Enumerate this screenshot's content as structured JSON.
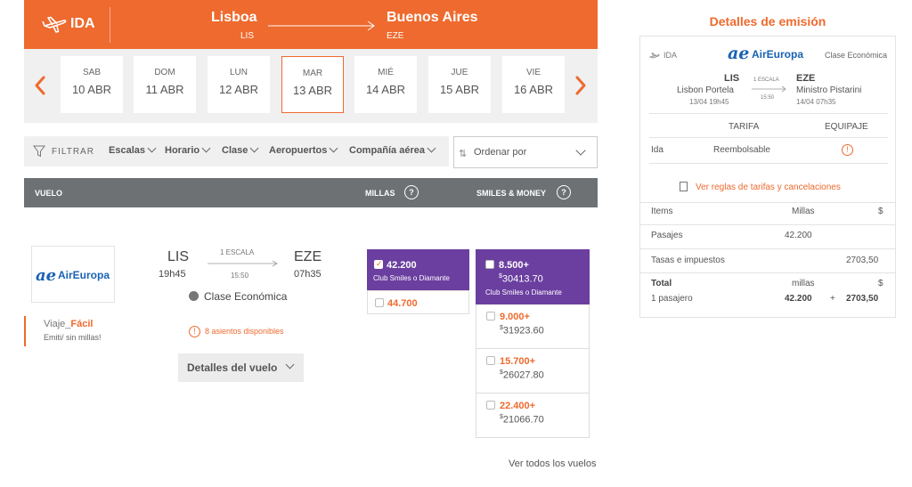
{
  "colors": {
    "brand_orange": "#ee6a2e",
    "smiles_purple": "#6b3fa0",
    "header_gray": "#6e7174",
    "aireuropa_blue": "#1a62b3"
  },
  "topbar": {
    "direction": "IDA",
    "origin_city": "Lisboa",
    "origin_code": "LIS",
    "dest_city": "Buenos Aires",
    "dest_code": "EZE"
  },
  "dates": [
    {
      "dow": "SAB",
      "day": "10 ABR",
      "selected": false
    },
    {
      "dow": "DOM",
      "day": "11 ABR",
      "selected": false
    },
    {
      "dow": "LUN",
      "day": "12 ABR",
      "selected": false
    },
    {
      "dow": "MAR",
      "day": "13 ABR",
      "selected": true
    },
    {
      "dow": "MIÉ",
      "day": "14 ABR",
      "selected": false
    },
    {
      "dow": "JUE",
      "day": "15 ABR",
      "selected": false
    },
    {
      "dow": "VIE",
      "day": "16 ABR",
      "selected": false
    }
  ],
  "filters": {
    "label": "FILTRAR",
    "items": [
      "Escalas",
      "Horario",
      "Clase",
      "Aeropuertos",
      "Compañía aérea"
    ],
    "sort_label": "Ordenar por"
  },
  "results_header": {
    "vuelo": "VUELO",
    "millas": "MILLAS",
    "smiles_money": "SMILES & MONEY",
    "help": "?"
  },
  "flight": {
    "airline_mark": "ae",
    "airline_name": "AirEuropa",
    "origin": "LIS",
    "dep_time": "19h45",
    "stops": "1 ESCALA",
    "duration": "15:50",
    "dest": "EZE",
    "arr_time": "07h35",
    "cabin": "Clase Económica",
    "seats": "8 asientos disponibles",
    "warn": "!",
    "details_button": "Detalles del vuelo"
  },
  "viaje_facil": {
    "prefix": "Viaje",
    "underscore": "_",
    "highlight": "Fácil",
    "subtitle": "Emiti/ sin millas!"
  },
  "millas": {
    "selected": {
      "value": "42.200",
      "subtitle": "Club Smiles o Diamante"
    },
    "alternative": {
      "value": "44.700"
    }
  },
  "smiles_money": {
    "selected": {
      "value": "8.500+",
      "currency": "$",
      "money": "30413.70",
      "subtitle": "Club Smiles o Diamante"
    },
    "options": [
      {
        "value": "9.000+",
        "currency": "$",
        "money": "31923.60"
      },
      {
        "value": "15.700+",
        "currency": "$",
        "money": "26027.80"
      },
      {
        "value": "22.400+",
        "currency": "$",
        "money": "21066.70"
      }
    ]
  },
  "ver_todos": "Ver todos los vuelos",
  "panel": {
    "title": "Detalles de emisión",
    "ida": "IDA",
    "airline_mark": "ae",
    "airline_name": "AirEuropa",
    "cabin": "Clase Económica",
    "origin_code": "LIS",
    "origin_name": "Lisbon Portela",
    "origin_date": "13/04 19h45",
    "stops": "1 ESCALA",
    "duration": "15:50",
    "dest_code": "EZE",
    "dest_name": "Ministro Pistarini",
    "dest_date": "14/04 07h35",
    "th_tarifa": "TARIFA",
    "th_equipaje": "EQUIPAJE",
    "row_ida": "Ida",
    "row_tarifa": "Reembolsable",
    "warn": "!",
    "rules_link": "Ver reglas de tarifas y cancelaciones",
    "items_header": "Items",
    "millas_header": "Millas",
    "money_header": "$",
    "pasajes_label": "Pasajes",
    "pasajes_millas": "42.200",
    "tasas_label": "Tasas e impuestos",
    "tasas_money": "2703,50",
    "total_label": "Total",
    "total_millas_unit": "millas",
    "total_money_unit": "$",
    "pasajero_label": "1 pasajero",
    "total_millas": "42.200",
    "plus": "+",
    "total_money": "2703,50"
  }
}
